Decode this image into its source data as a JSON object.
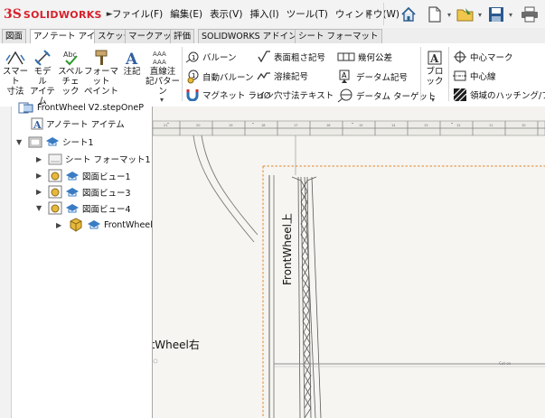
{
  "app": {
    "brand_prefix": "3S",
    "brand": "SOLIDWORKS"
  },
  "menu": [
    "ファイル(F)",
    "編集(E)",
    "表示(V)",
    "挿入(I)",
    "ツール(T)",
    "ウィンドウ(W)"
  ],
  "tabs": [
    {
      "label": "図面",
      "active": false
    },
    {
      "label": "アノテート アイテム",
      "active": true
    },
    {
      "label": "スケッチ",
      "active": false
    },
    {
      "label": "マークアップ",
      "active": false
    },
    {
      "label": "評価",
      "active": false
    },
    {
      "label": "SOLIDWORKS アドイン",
      "active": false
    },
    {
      "label": "シート フォーマット",
      "active": false
    }
  ],
  "ribbon": {
    "smart_dim": {
      "line1": "スマート",
      "line2": "寸法"
    },
    "model_items": {
      "line1": "モデル",
      "line2": "アイテム"
    },
    "spell_check": {
      "line1": "スペル",
      "line2": "チェック"
    },
    "format_painter": {
      "line1": "フォーマット",
      "line2": "ペイント"
    },
    "note": {
      "label": "注記"
    },
    "linear_note": {
      "line1": "直線注",
      "line2": "記パターン"
    },
    "balloon": "バルーン",
    "auto_balloon": "自動バルーン",
    "magnetic_line": "マグネット ライン",
    "surface_finish": "表面粗さ記号",
    "weld_symbol": "溶接記号",
    "hole_callout": "穴寸法テキスト",
    "gdt": "幾何公差",
    "datum_feature": "データム記号",
    "datum_target": "データム ターゲット",
    "block": "ブロック",
    "center_mark": "中心マーク",
    "centerline": "中心線",
    "area_hatch": "領域のハッチング/フィル"
  },
  "tree": {
    "root": "FrontWheel V2.stepOneP",
    "annotations": "アノテート アイテム",
    "sheet": "シート1",
    "sheet_format": "シート フォーマット1",
    "view1": "図面ビュー1",
    "view3": "図面ビュー3",
    "view4": "図面ビュー4",
    "part": "FrontWheel"
  },
  "drawing": {
    "top_label": "FrontWheel上",
    "right_label": "ntWheel右",
    "small_tag": "Cut-ex"
  }
}
